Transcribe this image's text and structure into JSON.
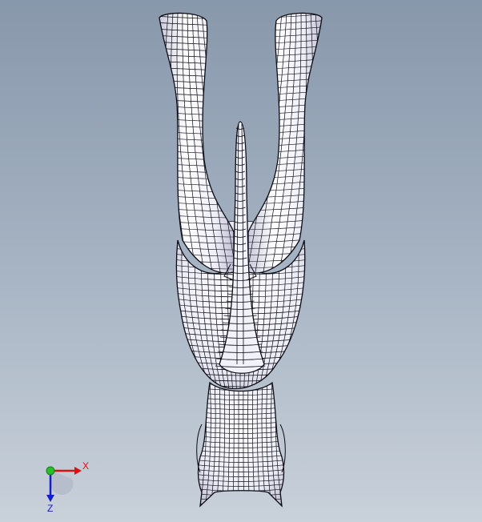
{
  "viewport": {
    "colors": {
      "top": "#8898ab",
      "mid": "#a2b0c0",
      "bottom": "#c9d1da"
    }
  },
  "model": {
    "icon": "wireframe-mesh-model",
    "surface_color": "#f4f4fb",
    "shade_color": "#c6c6d8",
    "line_color": "#0b0b14"
  },
  "triad": {
    "x_label": "X",
    "z_label": "Z",
    "colors": {
      "x": "#dd1010",
      "y": "#10b010",
      "z": "#1020c8",
      "origin": "#28c028"
    }
  }
}
